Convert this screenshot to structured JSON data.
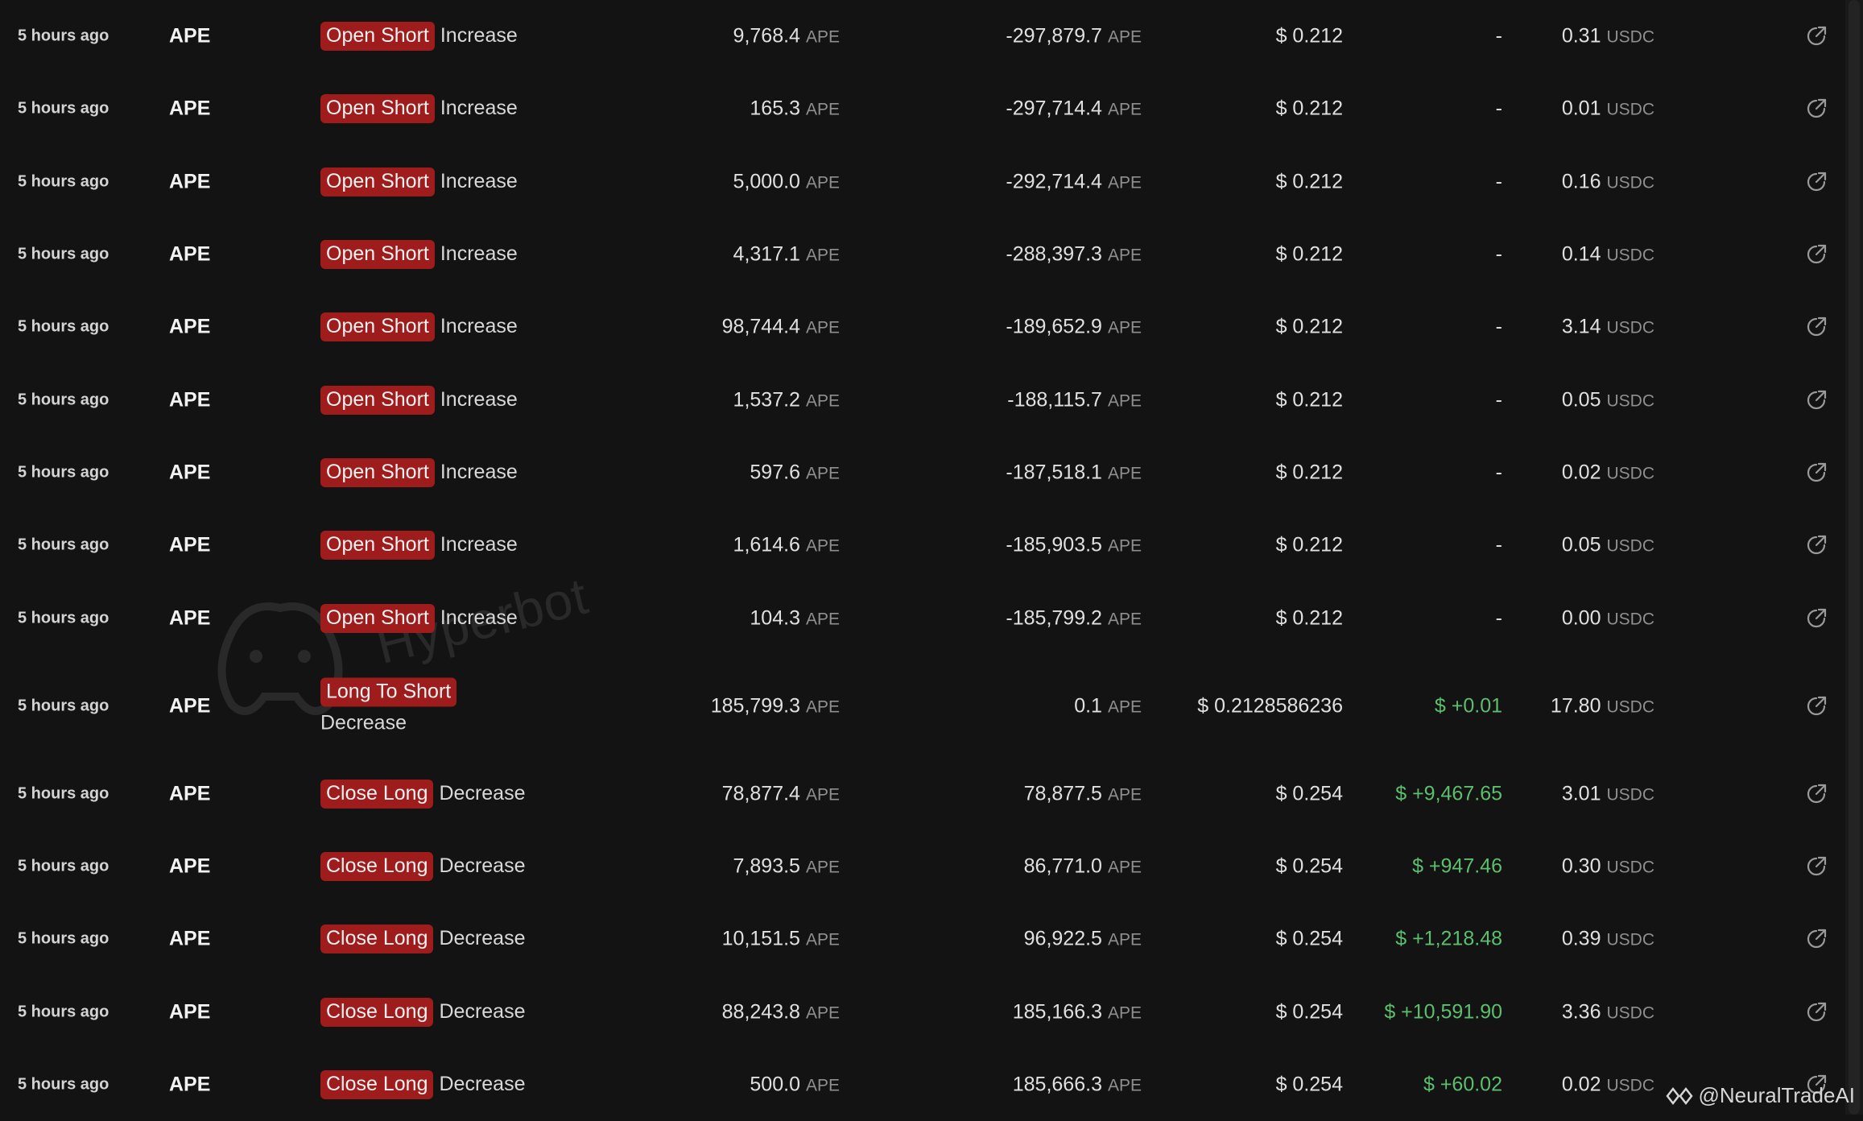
{
  "colors": {
    "background": "#131313",
    "badge_red": "#9e1c1c",
    "positive_green": "#5cbf6d",
    "muted_unit": "#8f8f8f"
  },
  "watermark": {
    "text": "Hyperbot"
  },
  "credit": {
    "text": "@NeuralTradeAI",
    "icon": "diamond-logo-icon"
  },
  "rows": [
    {
      "time": "5 hours ago",
      "token": "APE",
      "badge": "Open Short",
      "direction": "Increase",
      "size": "9,768.4",
      "size_unit": "APE",
      "position": "-297,879.7",
      "position_unit": "APE",
      "price": "$ 0.212",
      "pnl": "-",
      "fee": "0.31",
      "fee_unit": "USDC"
    },
    {
      "time": "5 hours ago",
      "token": "APE",
      "badge": "Open Short",
      "direction": "Increase",
      "size": "165.3",
      "size_unit": "APE",
      "position": "-297,714.4",
      "position_unit": "APE",
      "price": "$ 0.212",
      "pnl": "-",
      "fee": "0.01",
      "fee_unit": "USDC"
    },
    {
      "time": "5 hours ago",
      "token": "APE",
      "badge": "Open Short",
      "direction": "Increase",
      "size": "5,000.0",
      "size_unit": "APE",
      "position": "-292,714.4",
      "position_unit": "APE",
      "price": "$ 0.212",
      "pnl": "-",
      "fee": "0.16",
      "fee_unit": "USDC"
    },
    {
      "time": "5 hours ago",
      "token": "APE",
      "badge": "Open Short",
      "direction": "Increase",
      "size": "4,317.1",
      "size_unit": "APE",
      "position": "-288,397.3",
      "position_unit": "APE",
      "price": "$ 0.212",
      "pnl": "-",
      "fee": "0.14",
      "fee_unit": "USDC"
    },
    {
      "time": "5 hours ago",
      "token": "APE",
      "badge": "Open Short",
      "direction": "Increase",
      "size": "98,744.4",
      "size_unit": "APE",
      "position": "-189,652.9",
      "position_unit": "APE",
      "price": "$ 0.212",
      "pnl": "-",
      "fee": "3.14",
      "fee_unit": "USDC"
    },
    {
      "time": "5 hours ago",
      "token": "APE",
      "badge": "Open Short",
      "direction": "Increase",
      "size": "1,537.2",
      "size_unit": "APE",
      "position": "-188,115.7",
      "position_unit": "APE",
      "price": "$ 0.212",
      "pnl": "-",
      "fee": "0.05",
      "fee_unit": "USDC"
    },
    {
      "time": "5 hours ago",
      "token": "APE",
      "badge": "Open Short",
      "direction": "Increase",
      "size": "597.6",
      "size_unit": "APE",
      "position": "-187,518.1",
      "position_unit": "APE",
      "price": "$ 0.212",
      "pnl": "-",
      "fee": "0.02",
      "fee_unit": "USDC"
    },
    {
      "time": "5 hours ago",
      "token": "APE",
      "badge": "Open Short",
      "direction": "Increase",
      "size": "1,614.6",
      "size_unit": "APE",
      "position": "-185,903.5",
      "position_unit": "APE",
      "price": "$ 0.212",
      "pnl": "-",
      "fee": "0.05",
      "fee_unit": "USDC"
    },
    {
      "time": "5 hours ago",
      "token": "APE",
      "badge": "Open Short",
      "direction": "Increase",
      "size": "104.3",
      "size_unit": "APE",
      "position": "-185,799.2",
      "position_unit": "APE",
      "price": "$ 0.212",
      "pnl": "-",
      "fee": "0.00",
      "fee_unit": "USDC"
    },
    {
      "time": "5 hours ago",
      "token": "APE",
      "badge": "Long To Short",
      "direction": "Decrease",
      "size": "185,799.3",
      "size_unit": "APE",
      "position": "0.1",
      "position_unit": "APE",
      "price": "$ 0.2128586236",
      "pnl": "$ +0.01",
      "fee": "17.80",
      "fee_unit": "USDC"
    },
    {
      "time": "5 hours ago",
      "token": "APE",
      "badge": "Close Long",
      "direction": "Decrease",
      "size": "78,877.4",
      "size_unit": "APE",
      "position": "78,877.5",
      "position_unit": "APE",
      "price": "$ 0.254",
      "pnl": "$ +9,467.65",
      "fee": "3.01",
      "fee_unit": "USDC"
    },
    {
      "time": "5 hours ago",
      "token": "APE",
      "badge": "Close Long",
      "direction": "Decrease",
      "size": "7,893.5",
      "size_unit": "APE",
      "position": "86,771.0",
      "position_unit": "APE",
      "price": "$ 0.254",
      "pnl": "$ +947.46",
      "fee": "0.30",
      "fee_unit": "USDC"
    },
    {
      "time": "5 hours ago",
      "token": "APE",
      "badge": "Close Long",
      "direction": "Decrease",
      "size": "10,151.5",
      "size_unit": "APE",
      "position": "96,922.5",
      "position_unit": "APE",
      "price": "$ 0.254",
      "pnl": "$ +1,218.48",
      "fee": "0.39",
      "fee_unit": "USDC"
    },
    {
      "time": "5 hours ago",
      "token": "APE",
      "badge": "Close Long",
      "direction": "Decrease",
      "size": "88,243.8",
      "size_unit": "APE",
      "position": "185,166.3",
      "position_unit": "APE",
      "price": "$ 0.254",
      "pnl": "$ +10,591.90",
      "fee": "3.36",
      "fee_unit": "USDC"
    },
    {
      "time": "5 hours ago",
      "token": "APE",
      "badge": "Close Long",
      "direction": "Decrease",
      "size": "500.0",
      "size_unit": "APE",
      "position": "185,666.3",
      "position_unit": "APE",
      "price": "$ 0.254",
      "pnl": "$ +60.02",
      "fee": "0.02",
      "fee_unit": "USDC"
    }
  ]
}
